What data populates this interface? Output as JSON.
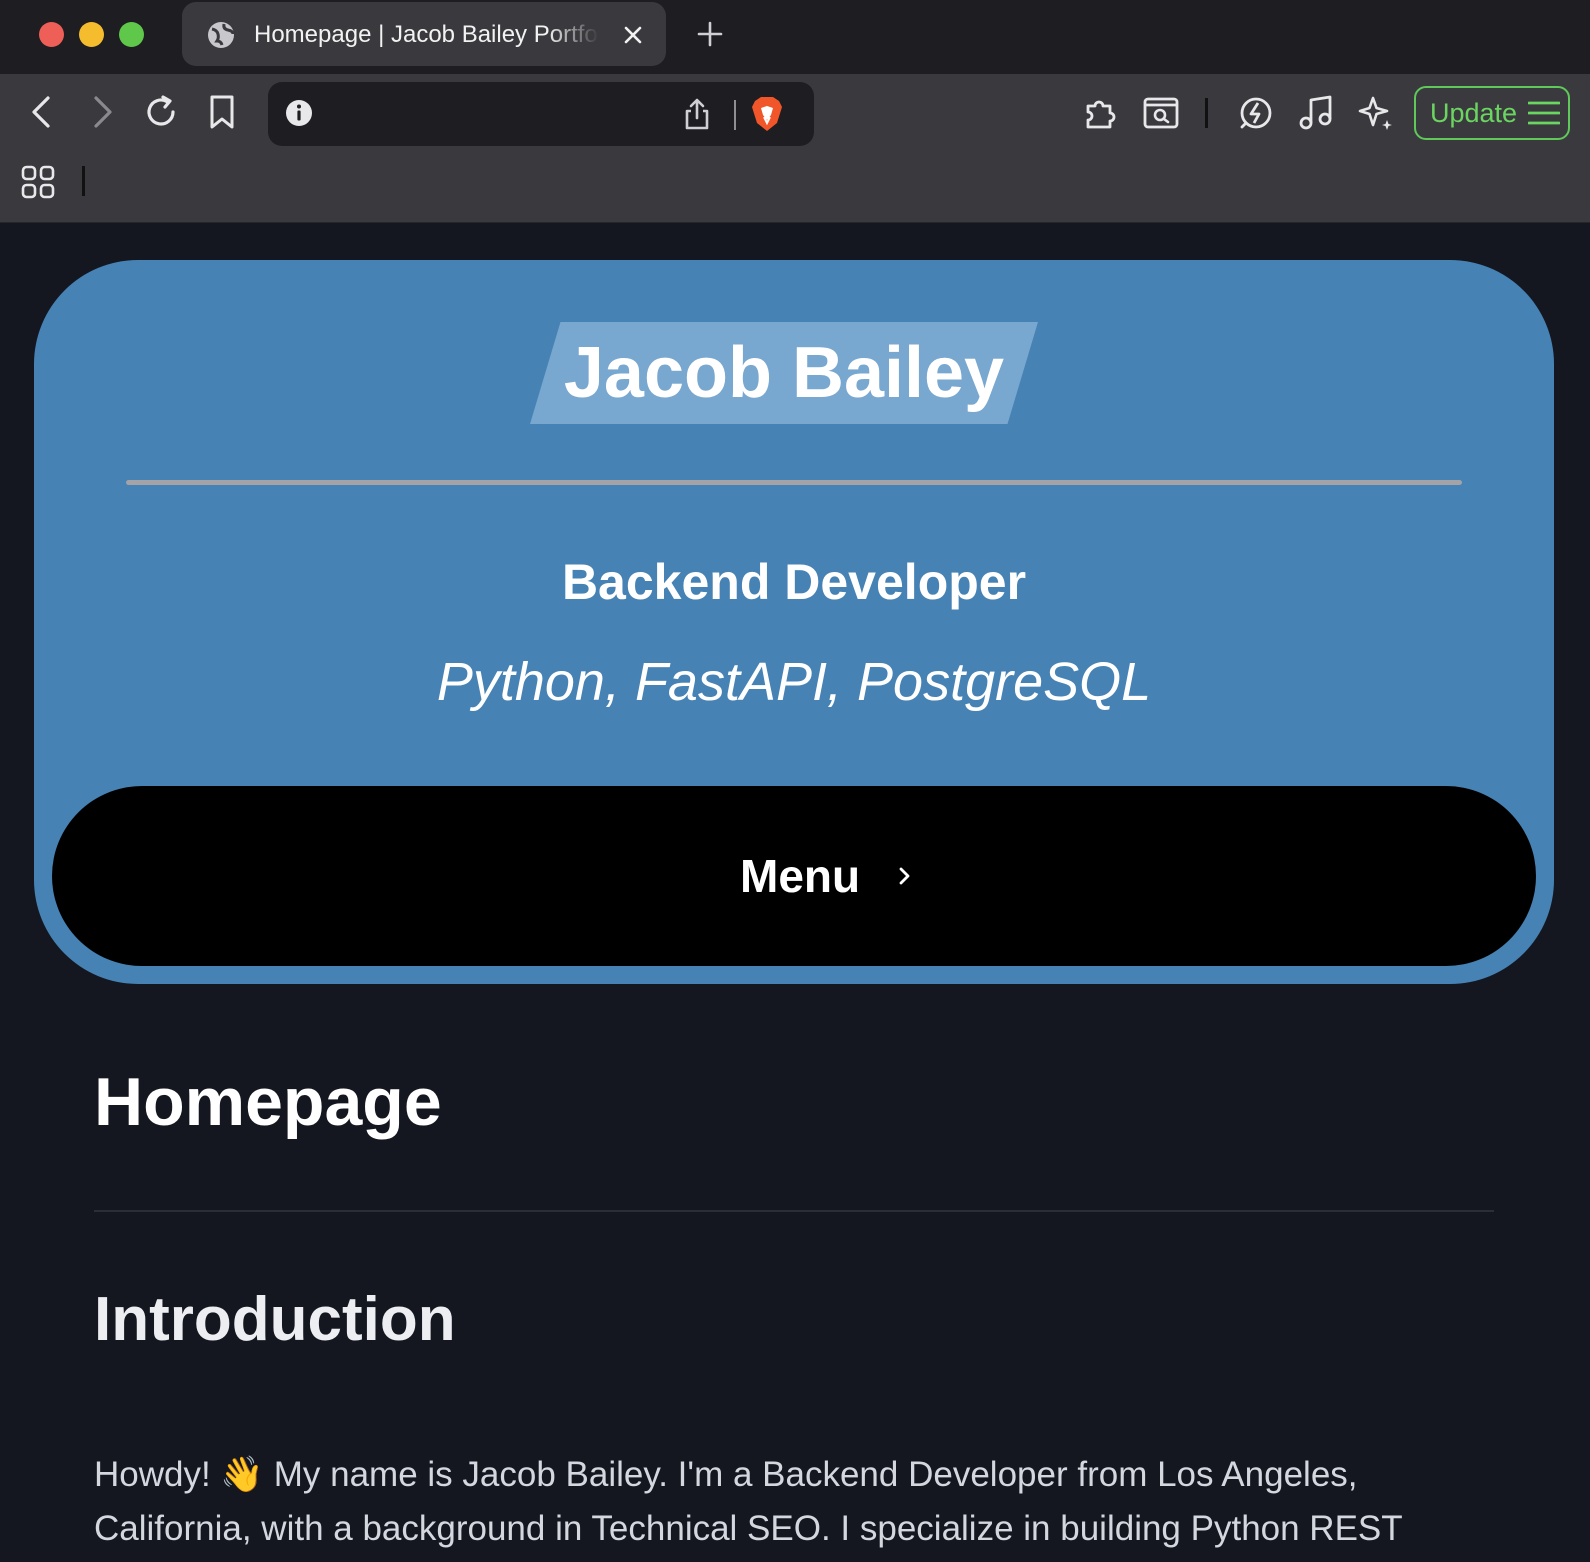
{
  "browser": {
    "tab": {
      "title": "Homepage | Jacob Bailey Portfolio"
    },
    "update_label": "Update",
    "accent_colors": {
      "update": "#5fc95a",
      "brave": "#f1562b"
    }
  },
  "hero": {
    "name": "Jacob Bailey",
    "role": "Backend Developer",
    "stack": "Python, FastAPI, PostgreSQL",
    "menu_label": "Menu",
    "colors": {
      "background": "#4682b4",
      "banner": "#78a7cf",
      "menu": "#000000"
    }
  },
  "main": {
    "page_title": "Homepage",
    "section_title": "Introduction",
    "intro_text": "Howdy! 👋 My name is Jacob Bailey. I'm a Backend Developer from Los Angeles, California, with a background in Technical SEO. I specialize in building Python REST"
  },
  "icons": [
    "globe-icon",
    "close-icon",
    "plus-icon",
    "back-icon",
    "forward-icon",
    "reload-icon",
    "bookmark-icon",
    "info-icon",
    "share-icon",
    "brave-shield-icon",
    "extensions-icon",
    "search-tab-icon",
    "leo-icon",
    "music-icon",
    "sparkle-icon",
    "hamburger-icon",
    "apps-grid-icon",
    "chevron-right-icon"
  ]
}
